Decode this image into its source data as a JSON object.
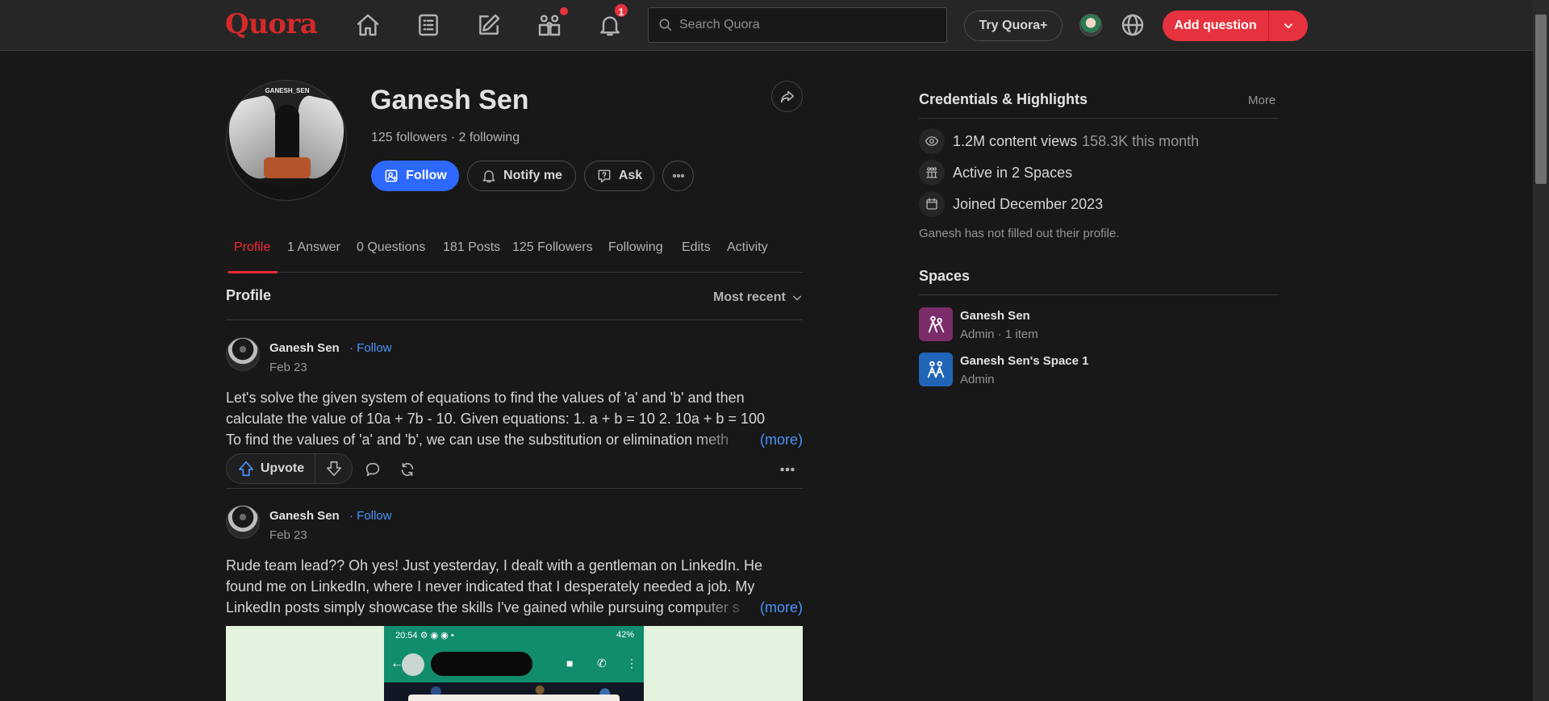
{
  "header": {
    "logo": "Quora",
    "search_placeholder": "Search Quora",
    "notifications_count": "1",
    "try_plus": "Try Quora+",
    "add_question": "Add question",
    "icons": [
      "home-icon",
      "following-feed-icon",
      "answer-icon",
      "spaces-icon",
      "notifications-icon",
      "globe-icon"
    ]
  },
  "profile": {
    "avatar_caption": "GANESH_SEN",
    "name": "Ganesh Sen",
    "stats": "125 followers · 2 following",
    "buttons": {
      "follow": "Follow",
      "notify": "Notify me",
      "ask": "Ask"
    }
  },
  "tabs": [
    {
      "label": "Profile",
      "active": true
    },
    {
      "label": "1 Answer"
    },
    {
      "label": "0 Questions"
    },
    {
      "label": "181 Posts"
    },
    {
      "label": "125 Followers"
    },
    {
      "label": "Following"
    },
    {
      "label": "Edits"
    },
    {
      "label": "Activity"
    }
  ],
  "feed": {
    "title": "Profile",
    "sort": "Most recent",
    "posts": [
      {
        "author": "Ganesh Sen",
        "follow": "· Follow",
        "date": "Feb 23",
        "lines": [
          "Let's solve the given system of equations to find the values of 'a' and 'b' and then",
          "calculate the value of 10a + 7b - 10. Given equations: 1. a + b = 10 2. 10a + b = 100",
          "To find the values of 'a' and 'b', we can use the substitution or elimination meth"
        ],
        "more": "(more)",
        "upvote": "Upvote"
      },
      {
        "author": "Ganesh Sen",
        "follow": "· Follow",
        "date": "Feb 23",
        "lines": [
          "Rude team lead?? Oh yes! Just yesterday, I dealt with a gentleman on LinkedIn. He",
          "found me on LinkedIn, where I never indicated that I desperately needed a job. My",
          "LinkedIn posts simply showcase the skills I've gained while pursuing computer s"
        ],
        "more": "(more)",
        "image": {
          "time": "20:54",
          "battery": "42%"
        }
      }
    ]
  },
  "sidebar": {
    "credentials_title": "Credentials & Highlights",
    "more": "More",
    "credentials": [
      {
        "icon": "eye-icon",
        "text": "1.2M content views",
        "sub": "158.3K this month"
      },
      {
        "icon": "spaces-icon",
        "text": "Active in 2 Spaces",
        "sub": ""
      },
      {
        "icon": "calendar-icon",
        "text": "Joined December 2023",
        "sub": ""
      }
    ],
    "note": "Ganesh has not filled out their profile.",
    "spaces_title": "Spaces",
    "spaces": [
      {
        "name": "Ganesh Sen",
        "role": "Admin · 1 item",
        "color": "#7a2c6a"
      },
      {
        "name": "Ganesh Sen's Space 1",
        "role": "Admin",
        "color": "#2165b8"
      }
    ]
  }
}
